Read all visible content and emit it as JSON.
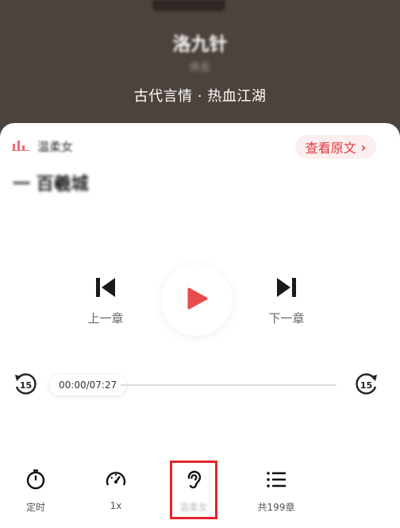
{
  "header": {
    "book_title": "洛九针",
    "author": "佚名",
    "genre": "古代言情 · 热血江湖"
  },
  "reader": {
    "name": "温柔女"
  },
  "view_original": {
    "label": "查看原文",
    "chevron": "›"
  },
  "chapter_title": "一 百羲城",
  "controls": {
    "prev_label": "上一章",
    "next_label": "下一章",
    "accent": "#e94b4b"
  },
  "progress": {
    "time": "00:00/07:27",
    "fraction": 0.0
  },
  "bottom_bar": {
    "items": [
      {
        "label": "定时",
        "icon": "timer-icon"
      },
      {
        "label": "1x",
        "icon": "speed-gauge-icon"
      },
      {
        "label": "温柔女",
        "icon": "ear-icon"
      },
      {
        "label": "共199章",
        "icon": "list-icon"
      }
    ]
  },
  "colors": {
    "header_bg": "#4d433d",
    "highlight_box": "#e0262b",
    "brand_red": "#e0393e"
  }
}
